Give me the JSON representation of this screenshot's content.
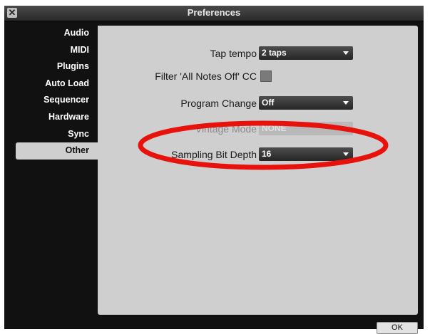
{
  "window": {
    "title": "Preferences",
    "close_glyph": "✕"
  },
  "sidebar": {
    "items": [
      {
        "label": "Audio"
      },
      {
        "label": "MIDI"
      },
      {
        "label": "Plugins"
      },
      {
        "label": "Auto Load"
      },
      {
        "label": "Sequencer"
      },
      {
        "label": "Hardware"
      },
      {
        "label": "Sync"
      },
      {
        "label": "Other",
        "selected": true
      }
    ]
  },
  "settings": {
    "tap_tempo": {
      "label": "Tap tempo",
      "value": "2 taps"
    },
    "filter_notes_off": {
      "label": "Filter 'All Notes Off' CC",
      "checked": false
    },
    "program_change": {
      "label": "Program Change",
      "value": "Off"
    },
    "vintage_mode": {
      "label": "Vintage Mode",
      "value": "NONE",
      "enabled": false
    },
    "sampling_bit_depth": {
      "label": "Sampling Bit Depth",
      "value": "16"
    }
  },
  "footer": {
    "ok_label": "OK"
  },
  "annotation": {
    "color": "#e8120c",
    "shape": "ellipse"
  }
}
